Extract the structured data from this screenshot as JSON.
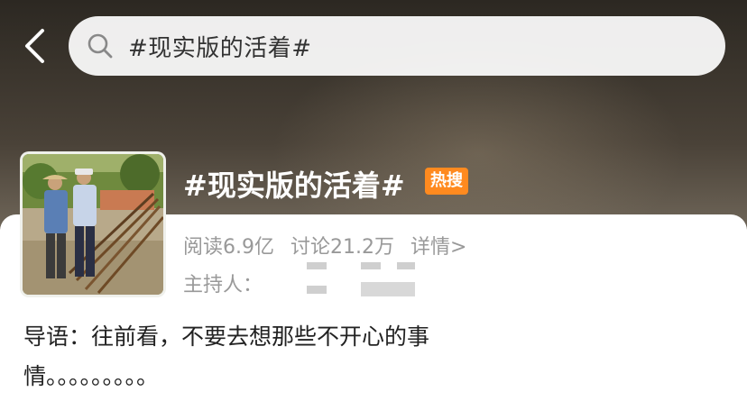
{
  "header": {
    "back_icon": "chevron-left-icon",
    "search": {
      "icon": "search-icon",
      "query": "#现实版的活着#"
    }
  },
  "topic": {
    "title": "#现实版的活着#",
    "badge": "热搜",
    "stats": {
      "reads": "阅读6.9亿",
      "discussions": "讨论21.2万",
      "details": "详情>"
    },
    "host_label": "主持人：",
    "intro": "导语：往前看，不要去想那些不开心的事情。。。。。。。。。"
  },
  "colors": {
    "badge": "#ff8a1f",
    "card": "#ffffff",
    "meta_text": "#999999"
  }
}
